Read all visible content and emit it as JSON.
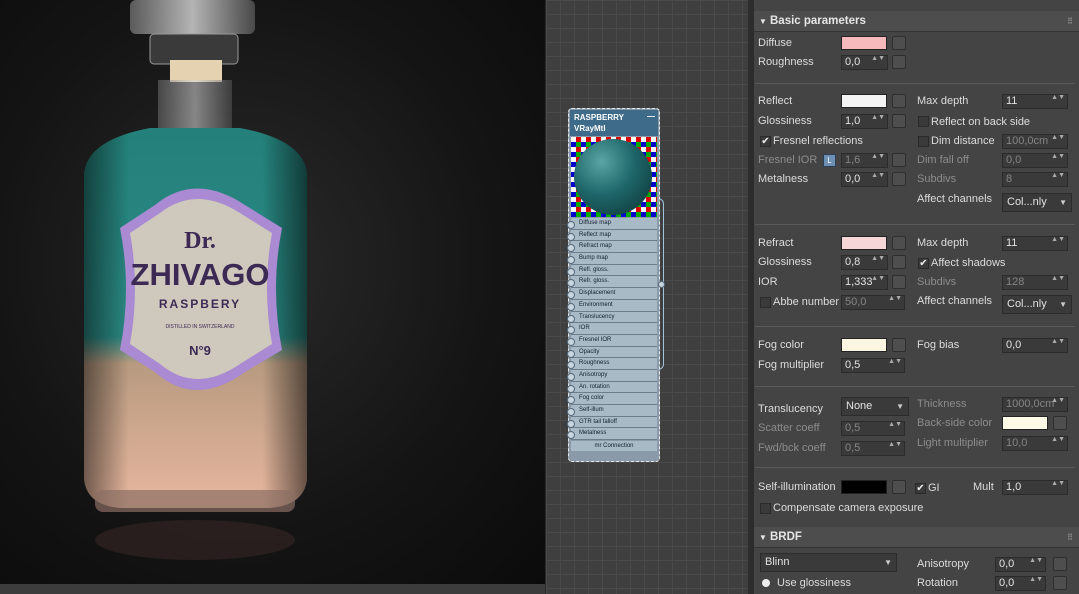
{
  "render": {
    "label_title": "Dr.",
    "label_name": "ZHIVAGO",
    "label_sub": "RASPBERY",
    "label_fine": "DISTILLED IN SWITZERLAND",
    "label_num": "N°9"
  },
  "node": {
    "title": "RASPBERRY",
    "type": "VRayMtl",
    "minimize": "—",
    "slots": [
      "Diffuse map",
      "Reflect map",
      "Refract map",
      "Bump map",
      "Refl. gloss.",
      "Refr. gloss.",
      "Displacement",
      "Environment",
      "Translucency",
      "IOR",
      "Fresnel IOR",
      "Opacity",
      "Roughness",
      "Anisotropy",
      "An. rotation",
      "Fog color",
      "Self-illum",
      "GTR tail falloff",
      "Metalness"
    ],
    "footer": "mr Connection"
  },
  "rollouts": {
    "basic": "Basic parameters",
    "brdf": "BRDF",
    "expand_glyph": "▼",
    "grip_glyph": "⠿"
  },
  "colors": {
    "diffuse": "#f6b9bc",
    "reflect": "#f4f4f4",
    "refract": "#f7d6d8",
    "fog": "#fbf6e2",
    "backside": "#fdfbe8",
    "selfillum": "#000000"
  },
  "basic": {
    "diffuse_label": "Diffuse",
    "roughness_label": "Roughness",
    "roughness": "0,0",
    "reflect_label": "Reflect",
    "glossiness_label": "Glossiness",
    "refl_glossiness": "1,0",
    "fresnel_label": "Fresnel reflections",
    "fresnel_checked": "✔",
    "fresnel_ior_label": "Fresnel IOR",
    "fresnel_ior_lock": "L",
    "fresnel_ior": "1,6",
    "metalness_label": "Metalness",
    "metalness": "0,0",
    "max_depth_label": "Max depth",
    "refl_max_depth": "11",
    "reflect_back_label": "Reflect on back side",
    "dim_distance_label": "Dim distance",
    "dim_distance": "100,0cm",
    "dim_falloff_label": "Dim fall off",
    "dim_falloff": "0,0",
    "subdivs_label": "Subdivs",
    "refl_subdivs": "8",
    "affect_channels_label": "Affect channels",
    "refl_affect_channels": "Col...nly",
    "refract_label": "Refract",
    "refr_glossiness": "0,8",
    "ior_label": "IOR",
    "ior": "1,333",
    "abbe_label": "Abbe number",
    "abbe": "50,0",
    "refr_max_depth": "11",
    "affect_shadows_label": "Affect shadows",
    "affect_shadows_checked": "✔",
    "refr_subdivs": "128",
    "refr_affect_channels": "Col...nly",
    "fog_color_label": "Fog color",
    "fog_multiplier_label": "Fog multiplier",
    "fog_multiplier": "0,5",
    "fog_bias_label": "Fog bias",
    "fog_bias": "0,0",
    "translucency_label": "Translucency",
    "translucency": "None",
    "scatter_label": "Scatter coeff",
    "scatter": "0,5",
    "fwdbck_label": "Fwd/bck coeff",
    "fwdbck": "0,5",
    "thickness_label": "Thickness",
    "thickness": "1000,0cm",
    "backside_label": "Back-side color",
    "light_mult_label": "Light multiplier",
    "light_mult": "10,0",
    "selfillum_label": "Self-illumination",
    "gi_label": "GI",
    "gi_checked": "✔",
    "mult_label": "Mult",
    "mult": "1,0",
    "compensate_label": "Compensate camera exposure"
  },
  "brdf": {
    "type": "Blinn",
    "use_glossiness_label": "Use glossiness",
    "anisotropy_label": "Anisotropy",
    "anisotropy": "0,0",
    "rotation_label": "Rotation",
    "rotation": "0,0"
  },
  "spinner_glyph": "▲▼",
  "dropdown_glyph": "▼"
}
